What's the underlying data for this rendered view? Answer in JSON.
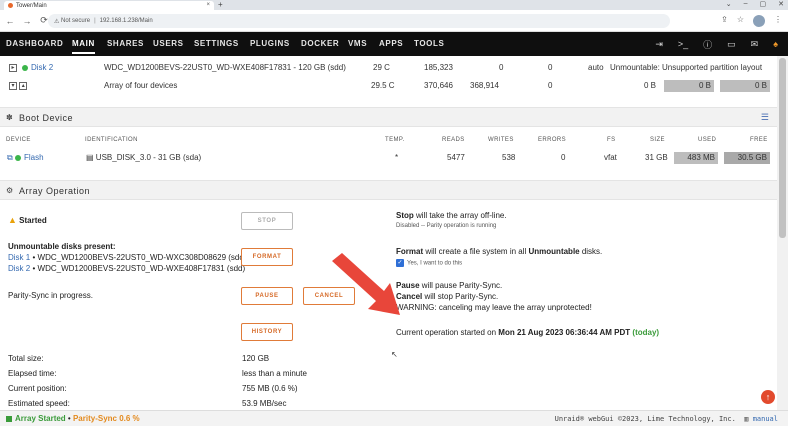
{
  "browser": {
    "tab_title": "Tower/Main",
    "close_glyph": "×",
    "new_tab_glyph": "+",
    "win_controls": [
      "⌄",
      "–",
      "▢",
      "✕"
    ],
    "back_glyph": "←",
    "forward_glyph": "→",
    "reload_glyph": "⟳",
    "security_label": "Not secure",
    "url": "192.168.1.238/Main",
    "icons": [
      "share-icon",
      "star-icon",
      "profile-avatar",
      "menu-icon"
    ]
  },
  "nav": {
    "items": [
      "DASHBOARD",
      "MAIN",
      "SHARES",
      "USERS",
      "SETTINGS",
      "PLUGINS",
      "DOCKER",
      "VMS",
      "APPS",
      "TOOLS"
    ],
    "active": "MAIN",
    "icons": [
      "logout-icon",
      "terminal-icon",
      "info-icon",
      "monitor-icon",
      "feedback-icon",
      "notifications-bell-icon"
    ]
  },
  "disk_rows": [
    {
      "name": "Disk 2",
      "identification": "WDC_WD1200BEVS-22UST0_WD-WXE408F17831 - 120 GB (sdd)",
      "temp": "29 C",
      "reads": "185,323",
      "writes": "0",
      "errors": "0",
      "fs": "auto",
      "status": "Unmountable: Unsupported partition layout"
    },
    {
      "identification": "Array of four devices",
      "temp": "29.5 C",
      "reads": "370,646",
      "writes": "368,914",
      "errors": "0",
      "size": "0 B",
      "used": "0 B",
      "free": "0 B"
    }
  ],
  "boot_device": {
    "title": "Boot Device",
    "headers": [
      "DEVICE",
      "IDENTIFICATION",
      "TEMP.",
      "READS",
      "WRITES",
      "ERRORS",
      "FS",
      "SIZE",
      "USED",
      "FREE"
    ],
    "row": {
      "device": "Flash",
      "identification": "USB_DISK_3.0 - 31 GB (sda)",
      "temp": "*",
      "reads": "5477",
      "writes": "538",
      "errors": "0",
      "fs": "vfat",
      "size": "31 GB",
      "used": "483 MB",
      "free": "30.5 GB"
    }
  },
  "array_op": {
    "title": "Array Operation",
    "status": "Started",
    "stop_label": "STOP",
    "unmountable_heading": "Unmountable disks present:",
    "unmountable": [
      {
        "disk": "Disk 1",
        "id": "WDC_WD1200BEVS-22UST0_WD-WXC308D08629 (sdc)"
      },
      {
        "disk": "Disk 2",
        "id": "WDC_WD1200BEVS-22UST0_WD-WXE408F17831 (sdd)"
      }
    ],
    "bullet": "•",
    "format_label": "FORMAT",
    "parity_text": "Parity-Sync in progress.",
    "pause_label": "PAUSE",
    "cancel_label": "CANCEL",
    "history_label": "HISTORY",
    "stop_desc_bold": "Stop",
    "stop_desc": " will take the array off-line.",
    "stop_note": "Disabled -- Parity operation is running",
    "format_desc_bold": "Format",
    "format_desc_mid": " will create a file system in all ",
    "format_desc_bold2": "Unmountable",
    "format_desc_end": " disks.",
    "format_confirm": "Yes, I want to do this",
    "pause_desc_bold": "Pause",
    "pause_desc": " will pause Parity-Sync.",
    "cancel_desc_bold": "Cancel",
    "cancel_desc": " will stop Parity-Sync.",
    "warning": "WARNING: canceling may leave the array unprotected!",
    "current_prefix": "Current operation started on ",
    "current_date": "Mon 21 Aug 2023 06:36:44 AM PDT",
    "current_today": "(today)",
    "stats": [
      {
        "label": "Total size:",
        "value": "120 GB"
      },
      {
        "label": "Elapsed time:",
        "value": "less than a minute"
      },
      {
        "label": "Current position:",
        "value": "755 MB (0.6 %)"
      },
      {
        "label": "Estimated speed:",
        "value": "53.9 MB/sec"
      }
    ]
  },
  "footer": {
    "array_status": "Array Started",
    "parity_status": "Parity-Sync 0.6 %",
    "copyright": "Unraid® webGui ©2023, Lime Technology, Inc.",
    "manual": "manual"
  },
  "colors": {
    "accent_orange": "#e07b39",
    "nav_bg": "#0f0f0f",
    "annotation_arrow": "#e8463a",
    "status_green": "#3bb54a"
  }
}
